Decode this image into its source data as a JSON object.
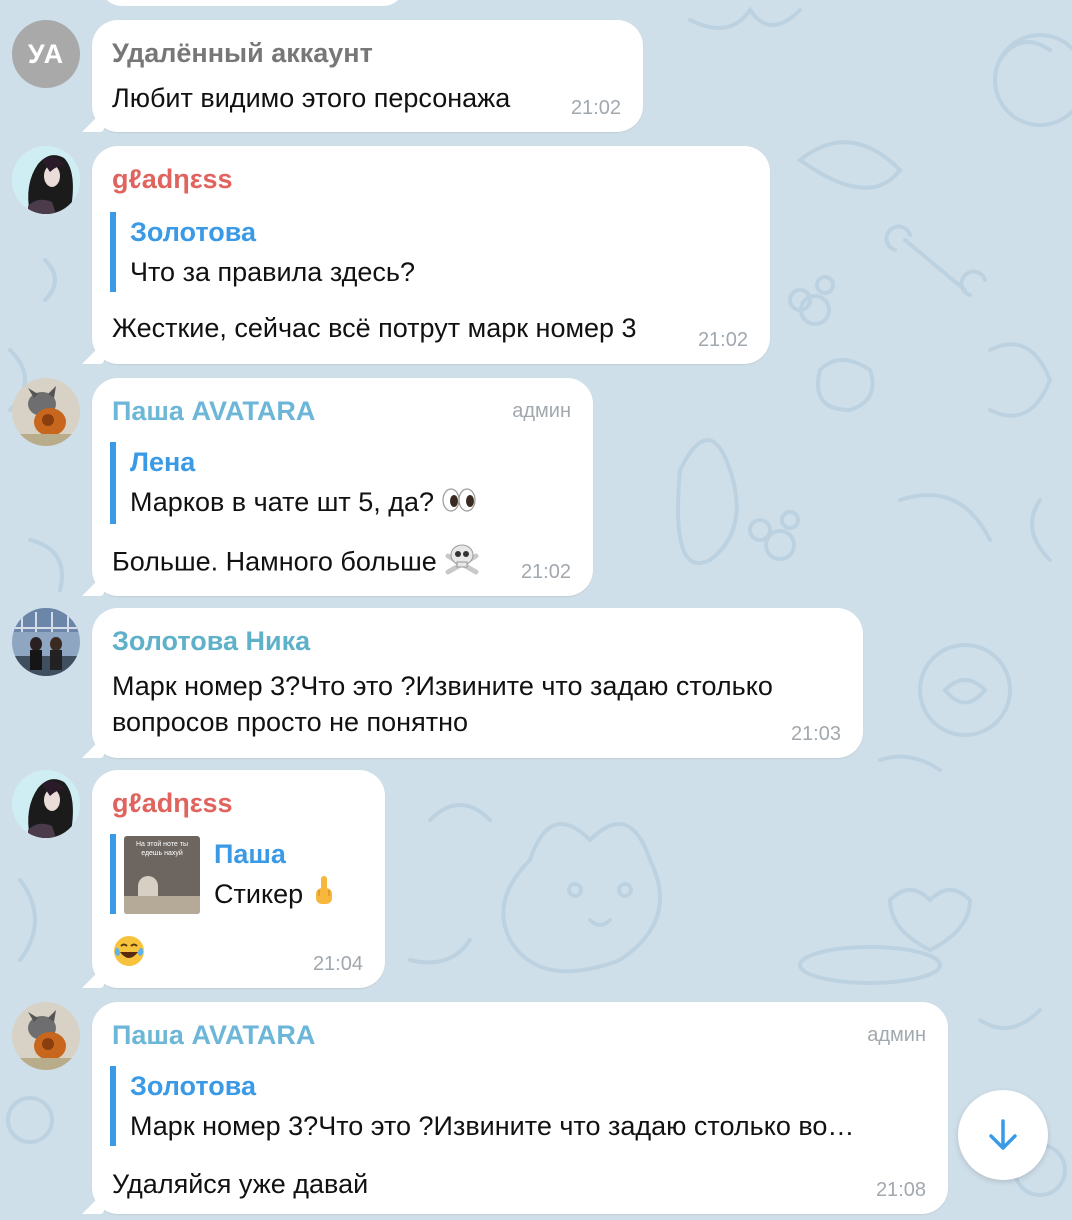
{
  "colors": {
    "background": "#cfdfea",
    "quote_accent": "#3a9ae6",
    "name_gladness": "#e0635d",
    "name_pasha": "#6cb6d8",
    "name_zolotova": "#5fb1c9",
    "name_deleted": "#777777",
    "meta_gray": "#a1a8ae"
  },
  "messages": [
    {
      "avatar": {
        "initials": "УА"
      },
      "sender": "Удалённый аккаунт",
      "text": "Любит видимо этого персонажа",
      "time": "21:02"
    },
    {
      "sender": "gℓadηεss",
      "reply": {
        "author": "Золотова",
        "text": "Что за правила здесь?"
      },
      "text": "Жесткие, сейчас всё потрут марк номер 3",
      "time": "21:02"
    },
    {
      "sender": "Паша AVATARA",
      "role": "админ",
      "reply": {
        "author": "Лена",
        "text": "Марков в чате шт 5, да?"
      },
      "text": "Больше. Намного больше",
      "time": "21:02",
      "icons": [
        "eyes-emoji",
        "skull-crossbones-emoji"
      ]
    },
    {
      "sender": "Золотова Ника",
      "text_line1": "Марк номер 3?Что это ?Извините что задаю столько",
      "text_line2": "вопросов просто не понятно",
      "time": "21:03"
    },
    {
      "sender": "gℓadηεss",
      "reply": {
        "author": "Паша",
        "text": "Стикер",
        "thumb_caption": "На этой ноте ты едешь нахуй"
      },
      "time": "21:04",
      "icons": [
        "middle-finger-emoji",
        "laughing-tears-emoji"
      ]
    },
    {
      "sender": "Паша AVATARA",
      "role": "админ",
      "reply": {
        "author": "Золотова",
        "text": "Марк номер 3?Что это ?Извините что задаю столько во…"
      },
      "text": "Удаляйся уже давай",
      "time": "21:08"
    }
  ],
  "scroll_button": {
    "icon": "arrow-down-icon"
  }
}
